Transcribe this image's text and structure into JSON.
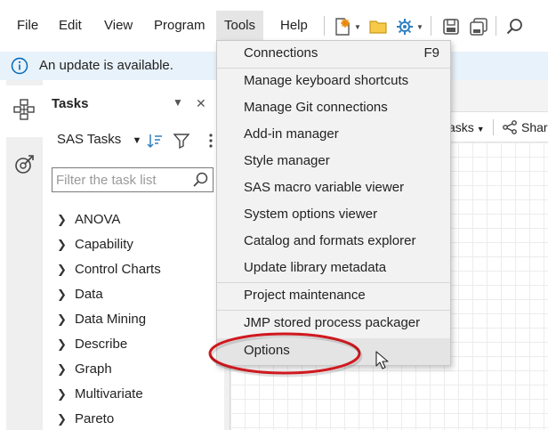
{
  "menubar": {
    "items": [
      "File",
      "Edit",
      "View",
      "Program",
      "Tools",
      "Help"
    ],
    "active": "Tools",
    "toolbar_icons": [
      "new-item-icon",
      "open-folder-icon",
      "settings-icon",
      "save-icon",
      "save-all-icon",
      "search-icon"
    ]
  },
  "infobar": {
    "text": "An update is available."
  },
  "rail": {
    "icons": [
      "tasks-icon",
      "snippets-icon"
    ]
  },
  "tasks_panel": {
    "title": "Tasks",
    "selector_label": "SAS Tasks",
    "search_placeholder": "Filter the task list",
    "items": [
      "ANOVA",
      "Capability",
      "Control Charts",
      "Data",
      "Data Mining",
      "Describe",
      "Graph",
      "Multivariate",
      "Pareto"
    ]
  },
  "workarea": {
    "tasks_dropdown_label": "asks",
    "share_label": "Shar"
  },
  "tools_menu": {
    "items": [
      {
        "label": "Connections",
        "shortcut": "F9"
      },
      {
        "label": "Manage keyboard shortcuts"
      },
      {
        "label": "Manage Git connections"
      },
      {
        "label": "Add-in manager"
      },
      {
        "label": "Style manager"
      },
      {
        "label": "SAS macro variable viewer"
      },
      {
        "label": "System options viewer"
      },
      {
        "label": "Catalog and formats explorer"
      },
      {
        "label": "Update library metadata"
      },
      {
        "label": "Project maintenance"
      },
      {
        "label": "JMP stored process packager"
      },
      {
        "label": "Options"
      }
    ],
    "highlighted": "Options"
  },
  "colors": {
    "accent": "#0067b8",
    "infobar_bg": "#e8f2fb",
    "annotation": "#d0191f",
    "menu_bg": "#f2f2f2"
  }
}
